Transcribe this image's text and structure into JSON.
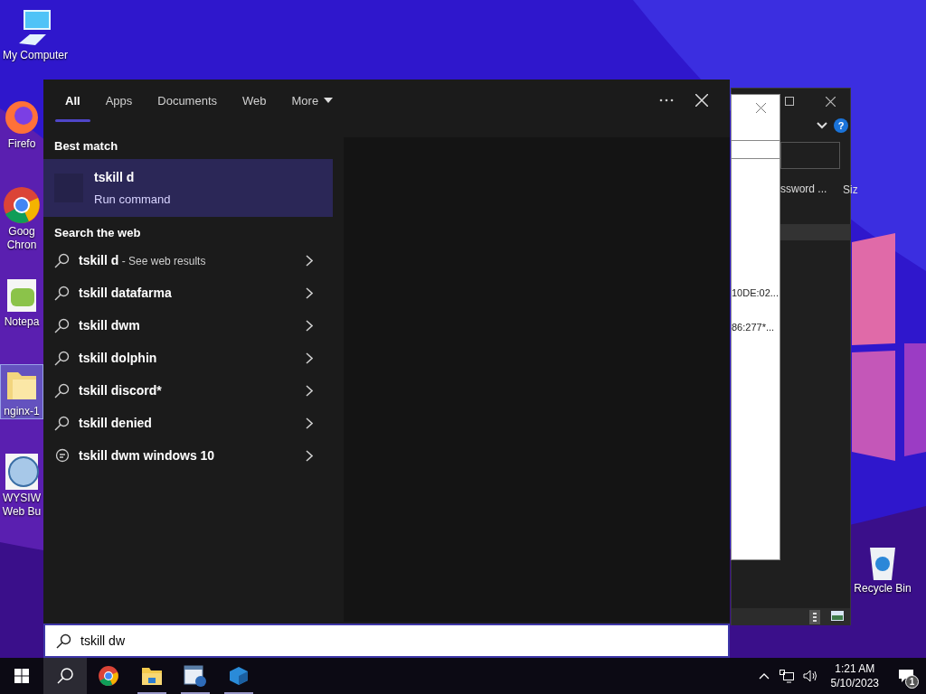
{
  "desktop_icons": [
    {
      "kind": "computer",
      "label": "My Computer",
      "selected": false
    },
    {
      "kind": "firefox",
      "label": "Firefo",
      "selected": false
    },
    {
      "kind": "chrome",
      "label": "Goog\nChron",
      "selected": false
    },
    {
      "kind": "notepad",
      "label": "Notepa",
      "selected": false
    },
    {
      "kind": "folder",
      "label": "nginx-1",
      "selected": true
    },
    {
      "kind": "globe",
      "label": "WYSIW\nWeb Bu",
      "selected": false
    },
    {
      "kind": "recycle",
      "label": "Recycle Bin",
      "selected": false
    }
  ],
  "background_window": {
    "help": "?",
    "column_1": "ssword ...",
    "column_2": "Siz",
    "rows": [
      "10DE:02...",
      "86:277*..."
    ]
  },
  "search_panel": {
    "tabs": [
      {
        "label": "All",
        "selected": true
      },
      {
        "label": "Apps",
        "selected": false
      },
      {
        "label": "Documents",
        "selected": false
      },
      {
        "label": "Web",
        "selected": false
      },
      {
        "label": "More",
        "selected": false
      }
    ],
    "best_match": {
      "heading": "Best match",
      "title": "tskill d",
      "subtitle": "Run command"
    },
    "web_heading": "Search the web",
    "suggestions": [
      {
        "kind": "search",
        "text": "tskill d",
        "suffix": "- See web results"
      },
      {
        "kind": "search",
        "text": "tskill datafarma"
      },
      {
        "kind": "search",
        "text": "tskill dwm"
      },
      {
        "kind": "search",
        "text": "tskill dolphin"
      },
      {
        "kind": "search",
        "text": "tskill discord*"
      },
      {
        "kind": "search",
        "text": "tskill denied"
      },
      {
        "kind": "chat",
        "text": "tskill dwm windows 10"
      }
    ],
    "search_box": {
      "value": "tskill dw"
    }
  },
  "taskbar": {
    "apps": [
      {
        "kind": "search",
        "selected": true
      },
      {
        "kind": "chrome",
        "selected": false
      },
      {
        "kind": "folder",
        "selected": false
      },
      {
        "kind": "webapp",
        "selected": false
      },
      {
        "kind": "cube",
        "selected": false
      }
    ],
    "time": "1:21 AM",
    "date": "5/10/2023",
    "notifications": "1"
  }
}
